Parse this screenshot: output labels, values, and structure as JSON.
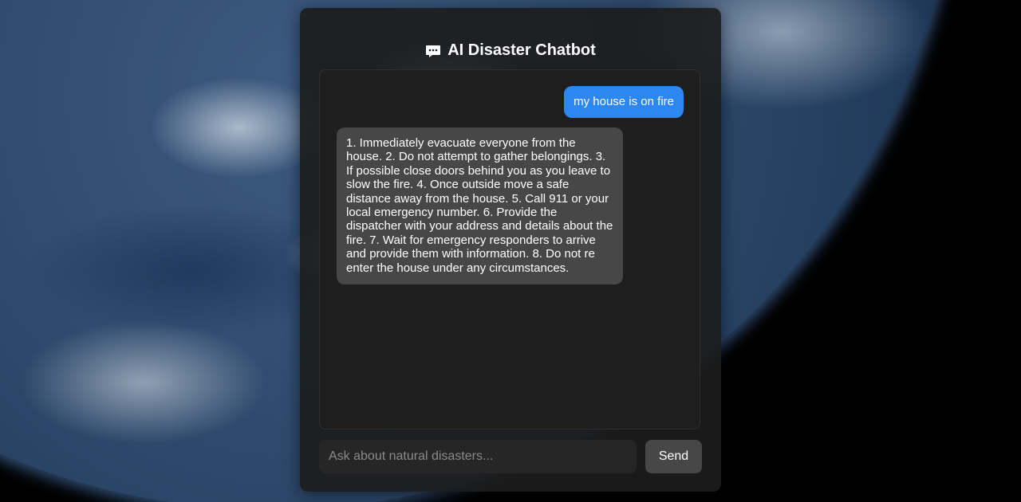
{
  "app": {
    "title": "AI Disaster Chatbot",
    "title_icon": "chat-bubble-icon"
  },
  "messages": [
    {
      "role": "user",
      "text": "my house is on fire",
      "color": "#2d87f0"
    },
    {
      "role": "bot",
      "text": "1. Immediately evacuate everyone from the house. 2. Do not attempt to gather belongings. 3. If possible close doors behind you as you leave to slow the fire. 4. Once outside move a safe distance away from the house. 5. Call 911 or your local emergency number. 6. Provide the dispatcher with your address and details about the fire. 7. Wait for emergency responders to arrive and provide them with information. 8. Do not re enter the house under any circumstances.",
      "color": "#474747"
    }
  ],
  "input": {
    "placeholder": "Ask about natural disasters...",
    "value": ""
  },
  "send_button": {
    "label": "Send"
  },
  "colors": {
    "panel": "#1c1c1c",
    "accent": "#2d87f0"
  }
}
